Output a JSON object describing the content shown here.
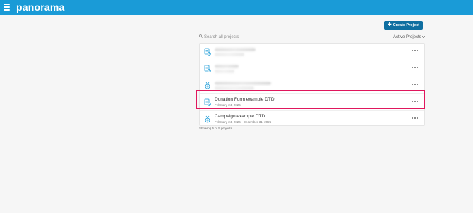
{
  "header": {
    "logo": "panorama",
    "menu_icon": "hamburger-menu-icon",
    "bar_color": "#1a9bd7"
  },
  "toolbar": {
    "create_label": "Create Project",
    "create_color": "#0f6fa1",
    "search_placeholder": "Search all projects",
    "filter_label": "Active Projects",
    "filter_icon": "chevron-down-icon"
  },
  "projects": [
    {
      "title": "",
      "date": "",
      "redacted": true,
      "icon": "form-icon"
    },
    {
      "title": "",
      "date": "",
      "redacted": true,
      "icon": "form-icon"
    },
    {
      "title": "",
      "date": "",
      "redacted": true,
      "icon": "campaign-icon"
    },
    {
      "title": "Donation Form example DTD",
      "date": "February 24, 2026",
      "icon": "form-icon",
      "highlighted": true
    },
    {
      "title": "Campaign example DTD",
      "date": "February 24, 2026 - December 31, 2026",
      "icon": "campaign-icon"
    }
  ],
  "footer": {
    "showing": "Showing 5 of 5 projects"
  },
  "highlight_color": "#e0175d"
}
